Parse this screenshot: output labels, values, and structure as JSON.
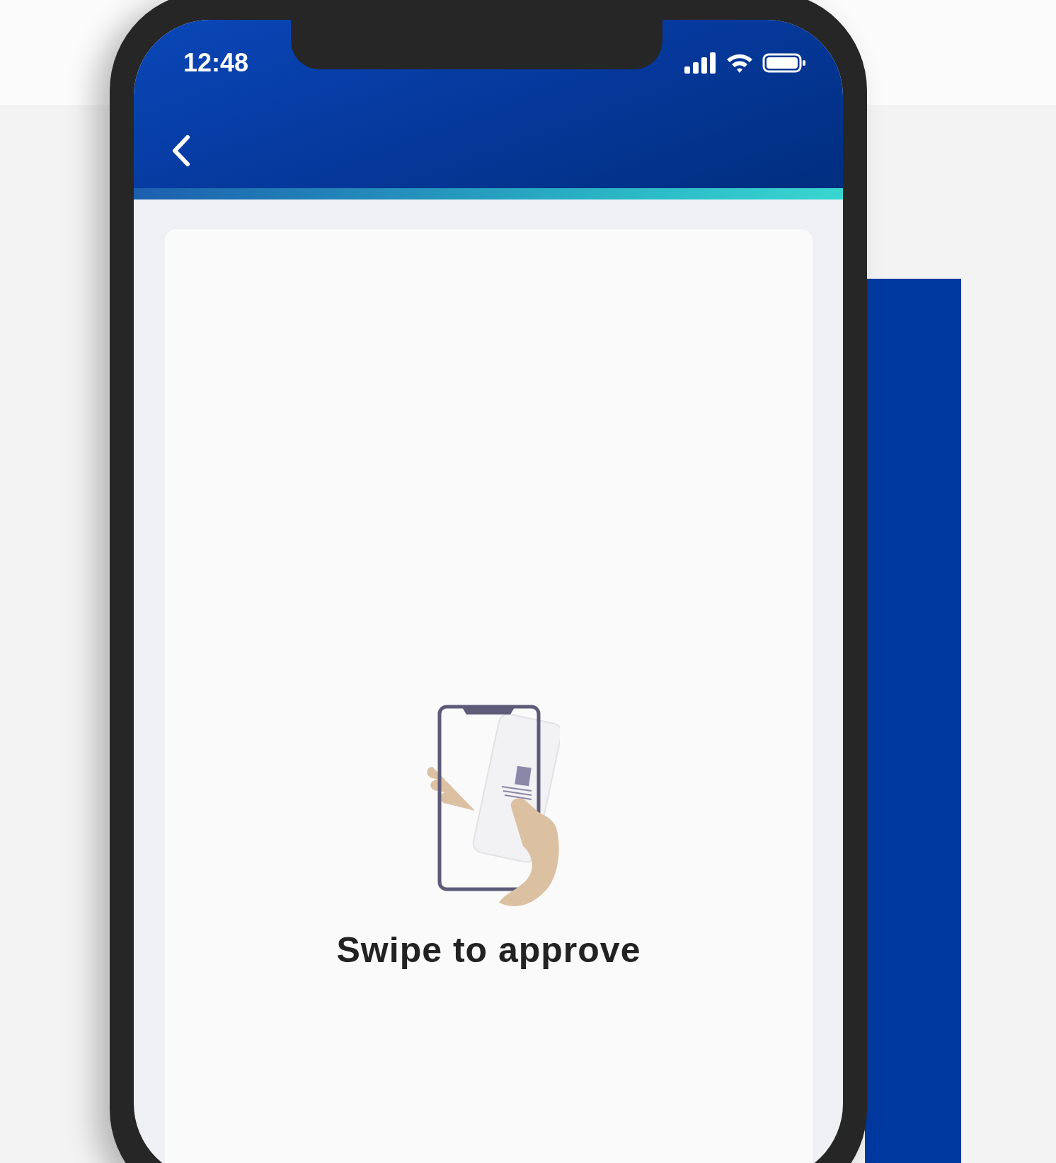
{
  "status_bar": {
    "time": "12:48"
  },
  "card": {
    "prompt": "Swipe to approve"
  }
}
